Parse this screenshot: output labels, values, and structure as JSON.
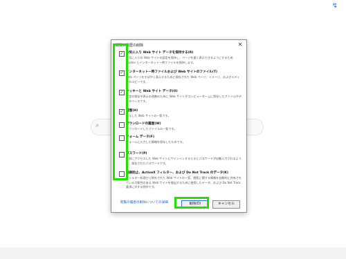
{
  "page": {
    "top_icon": "↯",
    "search_icon": "⌕"
  },
  "dialog": {
    "title": "閲覧の履歴の削除",
    "close": "✕",
    "items": [
      {
        "checked": true,
        "title": "お気に入り Web サイト データを保持する(R)",
        "desc": "お気に入りの Web サイトの設定を保持し、ページを速く表示できるようにするため Cookie とインターネット一時ファイルを保持します。"
      },
      {
        "checked": true,
        "title": "インターネット一時ファイルおよび Web サイトのファイル(T)",
        "desc": "Web ページをすばやく表示するために保存された Web ページ、イメージ、およびメディアのコピーです。"
      },
      {
        "checked": true,
        "title": "クッキーと Web サイト データ(O)",
        "desc": "設定の保存や表示の改善のために Web サイトがコンピューター上に保存したファイルやデータベースです。"
      },
      {
        "checked": true,
        "title": "履歴(H)",
        "desc": "表示した Web サイトの一覧です。"
      },
      {
        "checked": false,
        "title": "ダウンロードの履歴(W)",
        "desc": "ダウンロードしたファイルの一覧です。"
      },
      {
        "checked": false,
        "title": "フォーム データ(F)",
        "desc": "フォームに入力した情報を保存したものです。"
      },
      {
        "checked": false,
        "title": "パスワード(P)",
        "desc": "以前にアクセスした Web サイトにサインインするときにパスワードが自動入力されるように、保存されたパスワードです。"
      },
      {
        "checked": false,
        "title": "追跡防止、ActiveX フィルター、および Do Not Track のデータ(K)",
        "desc": "フィルター処理から除外された Web サイトの一覧、閲覧に関する情報を自動的に共有されている可能性のある Web サイトを検出するために使用したデータ、および Do Not Track 要求に対する例外です。"
      }
    ],
    "link": "閲覧の履歴の削除についての詳細",
    "delete_label": "削除(D)",
    "cancel_label": "キャンセル"
  }
}
